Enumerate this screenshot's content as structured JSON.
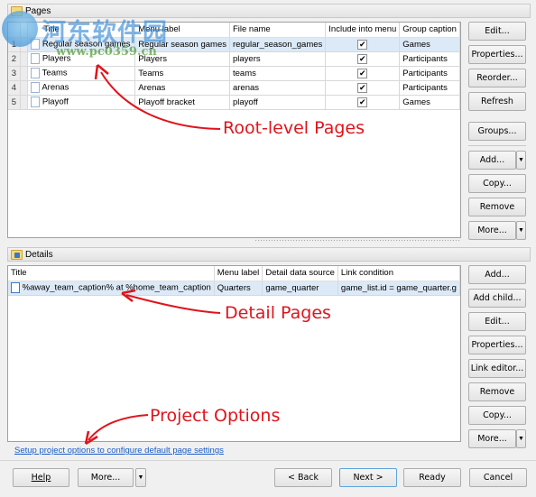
{
  "pages_section": {
    "title": "Pages",
    "columns": [
      "Title",
      "Menu label",
      "File name",
      "Include into menu",
      "Group caption"
    ],
    "rows": [
      {
        "num": "1",
        "title": "Regular season games",
        "menu_label": "Regular season games",
        "file_name": "regular_season_games",
        "include": true,
        "group": "Games",
        "selected": true
      },
      {
        "num": "2",
        "title": "Players",
        "menu_label": "Players",
        "file_name": "players",
        "include": true,
        "group": "Participants",
        "selected": false
      },
      {
        "num": "3",
        "title": "Teams",
        "menu_label": "Teams",
        "file_name": "teams",
        "include": true,
        "group": "Participants",
        "selected": false
      },
      {
        "num": "4",
        "title": "Arenas",
        "menu_label": "Arenas",
        "file_name": "arenas",
        "include": true,
        "group": "Participants",
        "selected": false
      },
      {
        "num": "5",
        "title": "Playoff",
        "menu_label": "Playoff bracket",
        "file_name": "playoff",
        "include": true,
        "group": "Games",
        "selected": false
      }
    ],
    "buttons": {
      "edit": "Edit...",
      "properties": "Properties...",
      "reorder": "Reorder...",
      "refresh": "Refresh",
      "groups": "Groups...",
      "add": "Add...",
      "copy": "Copy...",
      "remove": "Remove",
      "more": "More..."
    }
  },
  "details_section": {
    "title": "Details",
    "columns": [
      "Title",
      "Menu label",
      "Detail data source",
      "Link condition"
    ],
    "rows": [
      {
        "title": "%away_team_caption% at %home_team_caption",
        "menu_label": "Quarters",
        "data_source": "game_quarter",
        "link_condition": "game_list.id = game_quarter.g"
      }
    ],
    "buttons": {
      "add": "Add...",
      "add_child": "Add child...",
      "edit": "Edit...",
      "properties": "Properties...",
      "link_editor": "Link editor...",
      "remove": "Remove",
      "copy": "Copy...",
      "more": "More..."
    }
  },
  "project_options_link": "Setup project options to configure default page settings",
  "footer": {
    "help": "Help",
    "more": "More...",
    "back": "< Back",
    "next": "Next >",
    "ready": "Ready",
    "cancel": "Cancel"
  },
  "annotations": {
    "root_level": "Root-level Pages",
    "detail_pages": "Detail Pages",
    "project_options": "Project Options"
  },
  "watermark": {
    "text": "河东软件园",
    "url": "www.pc0359.cn"
  },
  "colors": {
    "annotation_red": "#e0141c",
    "link_blue": "#1b5ec9",
    "selection": "#dceaf7"
  }
}
